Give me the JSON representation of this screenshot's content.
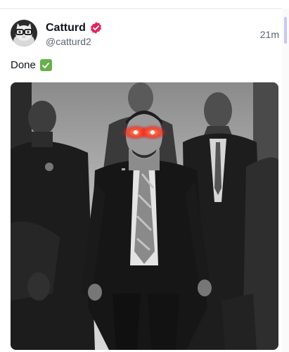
{
  "post": {
    "author": {
      "display_name": "Catturd",
      "handle": "@catturd2",
      "verified": true,
      "avatar_icon": "cat-with-glasses-avatar"
    },
    "timestamp": "21m",
    "text": "Done",
    "emoji": "check-mark-button-emoji",
    "media": {
      "type": "photo",
      "description_icon": "grayscale-photo-man-with-glowing-red-eyes"
    }
  },
  "colors": {
    "verified_badge": "#e0245e",
    "check_emoji": "#67b04a",
    "glow": "#ff2a1a",
    "scroll_thumb": "#c9c9f2"
  }
}
